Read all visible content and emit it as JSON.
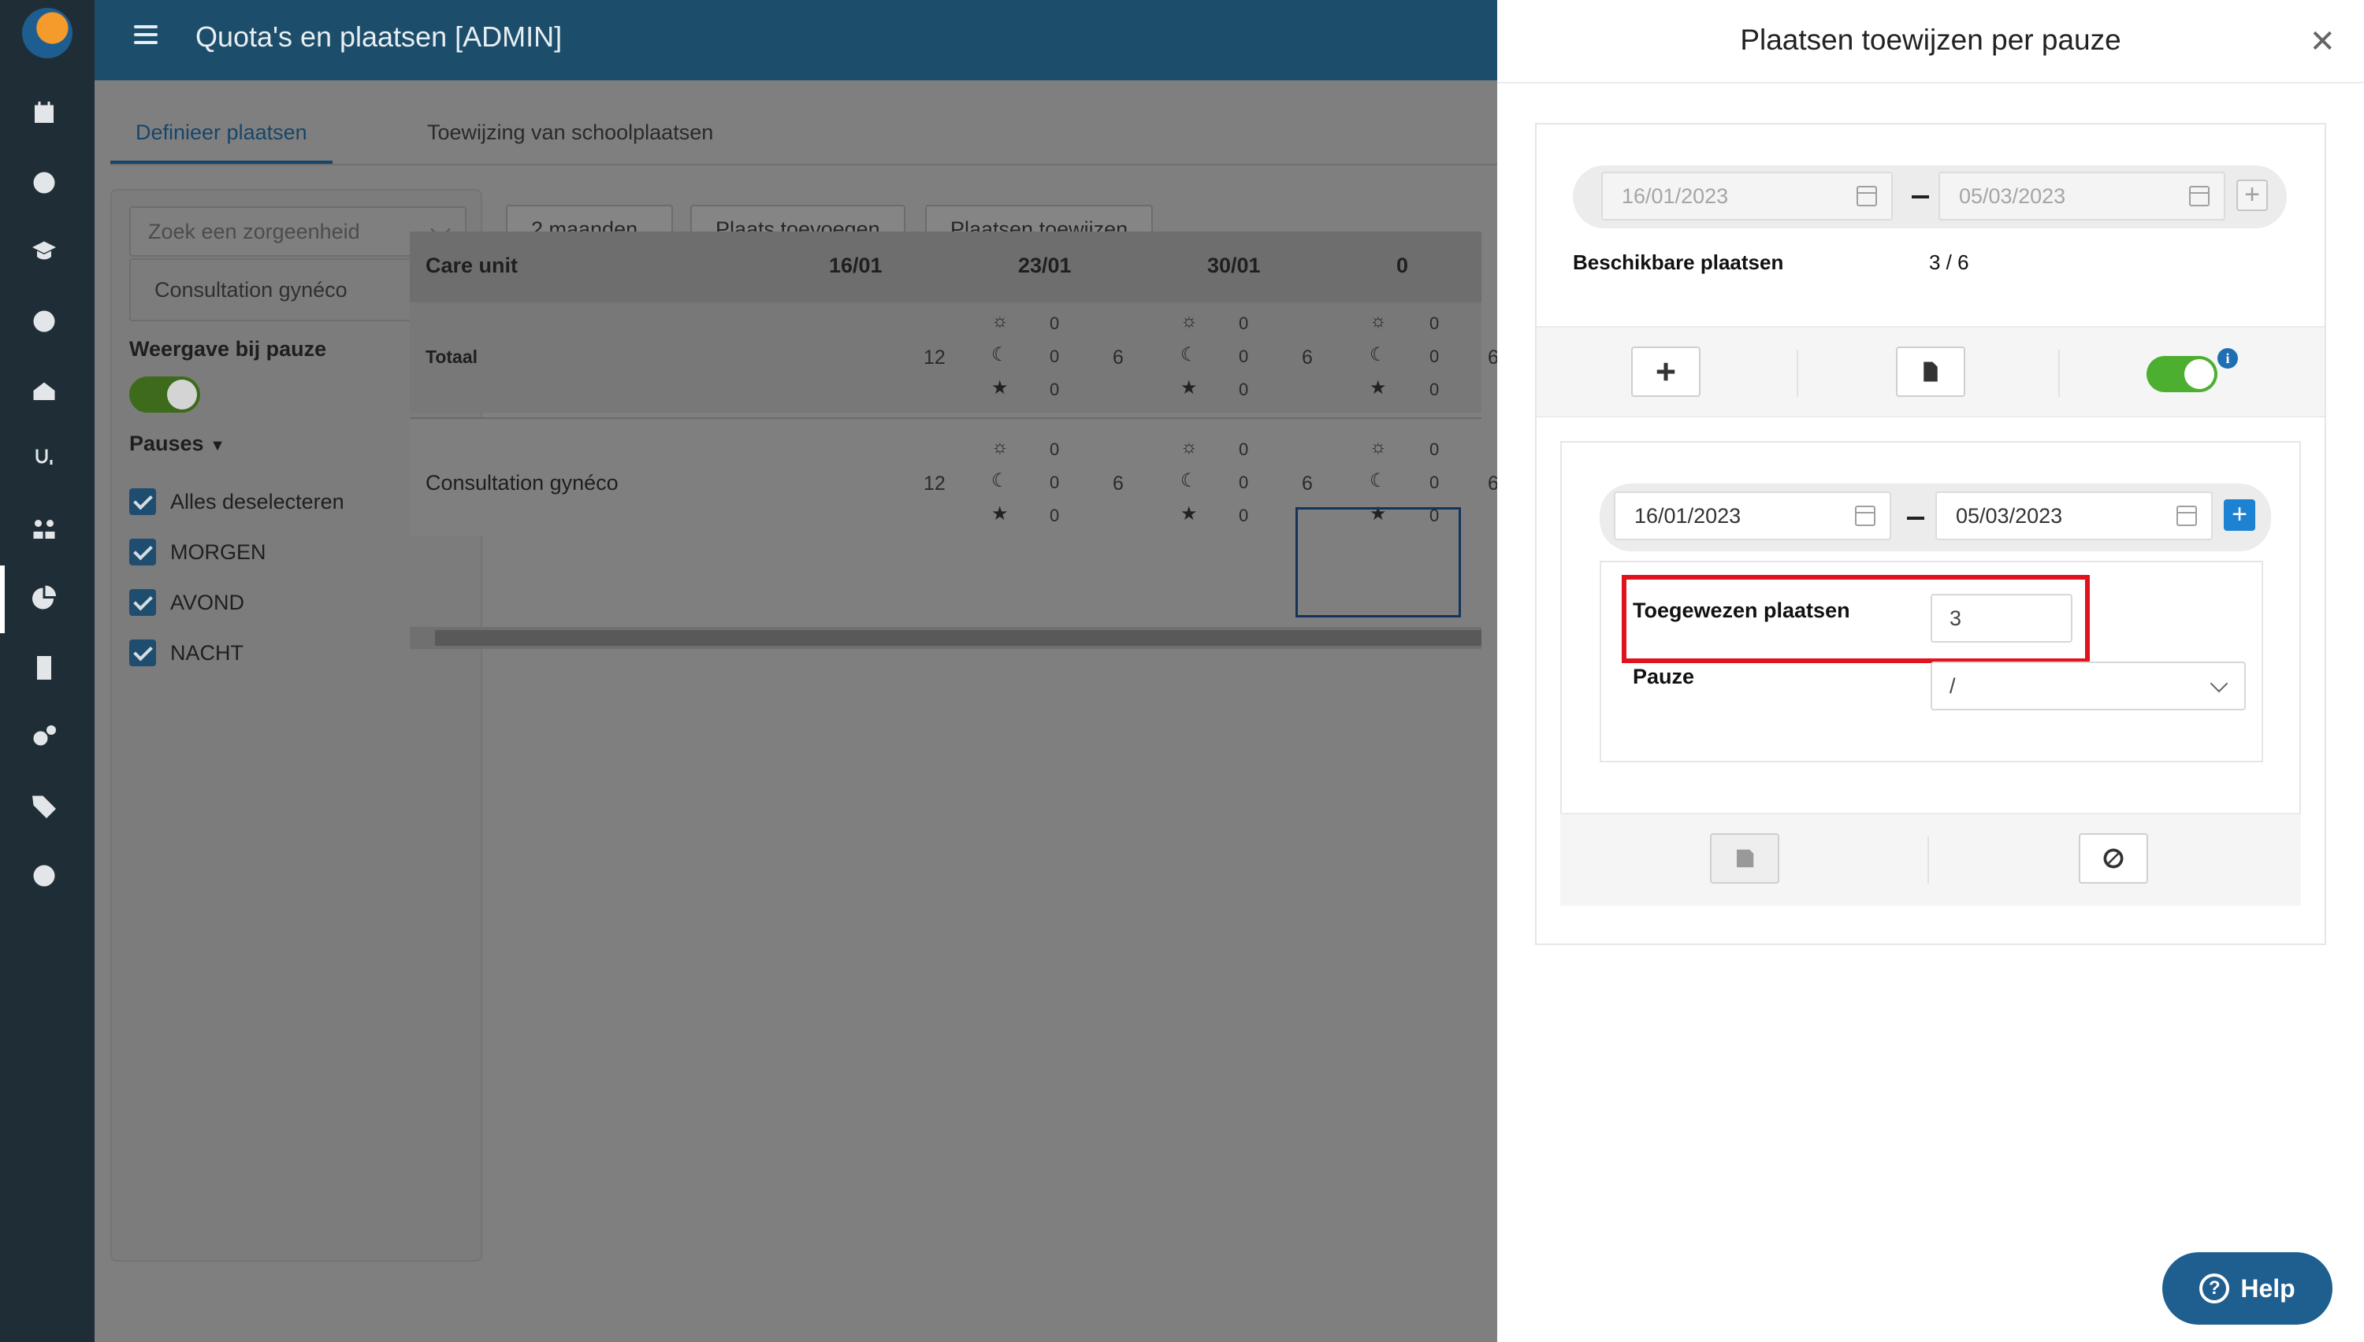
{
  "header": {
    "title": "Quota's en plaatsen [ADMIN]"
  },
  "tabs": [
    {
      "label": "Definieer plaatsen"
    },
    {
      "label": "Toewijzing van schoolplaatsen"
    }
  ],
  "filter": {
    "search_placeholder": "Zoek een zorgeenheid",
    "selected_unit": "Consultation gynéco",
    "view_by_pause_label": "Weergave bij pauze",
    "pauses_label": "Pauses",
    "checkboxes": [
      {
        "label": "Alles deselecteren"
      },
      {
        "label": "MORGEN"
      },
      {
        "label": "AVOND"
      },
      {
        "label": "NACHT"
      }
    ]
  },
  "toolbar": {
    "period_select": "2 maanden",
    "add_place_button": "Plaats toevoegen",
    "assign_places_button": "Plaatsen toewijzen"
  },
  "grid": {
    "col_header": "Care unit",
    "weeks": [
      "16/01",
      "23/01",
      "30/01",
      "0"
    ],
    "rows": [
      {
        "label": "Totaal",
        "totals": [
          "12",
          "6",
          "6",
          "6"
        ],
        "breakdown": [
          "0",
          "0",
          "0"
        ]
      },
      {
        "label": "Consultation gynéco",
        "totals": [
          "12",
          "6",
          "6",
          "6"
        ],
        "breakdown": [
          "0",
          "0",
          "0"
        ]
      }
    ]
  },
  "drawer": {
    "title": "Plaatsen toewijzen per pauze",
    "range_from": "16/01/2023",
    "range_to": "05/03/2023",
    "available_label": "Beschikbare plaatsen",
    "available_value": "3 / 6",
    "edit_from": "16/01/2023",
    "edit_to": "05/03/2023",
    "assigned_label": "Toegewezen plaatsen",
    "assigned_value": "3",
    "pause_label": "Pauze",
    "pause_value": "/"
  },
  "help": {
    "label": "Help"
  },
  "colors": {
    "accent": "#1c4e6b",
    "toggle_on": "#4caf30",
    "highlight": "#e0121d",
    "add_blue": "#1e82d2"
  }
}
